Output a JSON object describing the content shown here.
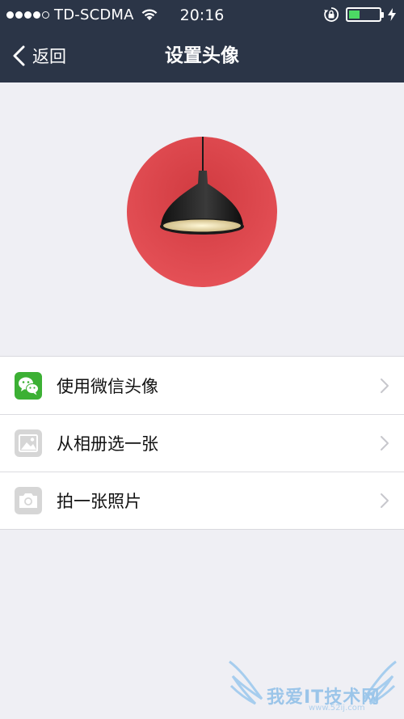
{
  "status_bar": {
    "carrier": "TD-SCDMA",
    "time": "20:16",
    "signal_bars_filled": 4,
    "signal_bars_total": 5,
    "battery_level": 0.35,
    "battery_color": "#4cd964"
  },
  "nav": {
    "back_label": "返回",
    "title": "设置头像",
    "background_color": "#2b3547"
  },
  "avatar": {
    "icon": "pendant-lamp-avatar"
  },
  "options": [
    {
      "label": "使用微信头像",
      "icon": "wechat-icon"
    },
    {
      "label": "从相册选一张",
      "icon": "photo-album-icon"
    },
    {
      "label": "拍一张照片",
      "icon": "camera-icon"
    }
  ],
  "watermark": {
    "text": "我爱IT技术网",
    "url": "www.52ij.com"
  },
  "colors": {
    "page_background": "#efeff4",
    "wechat_green": "#3cb034",
    "avatar_red": "#d8434a"
  }
}
